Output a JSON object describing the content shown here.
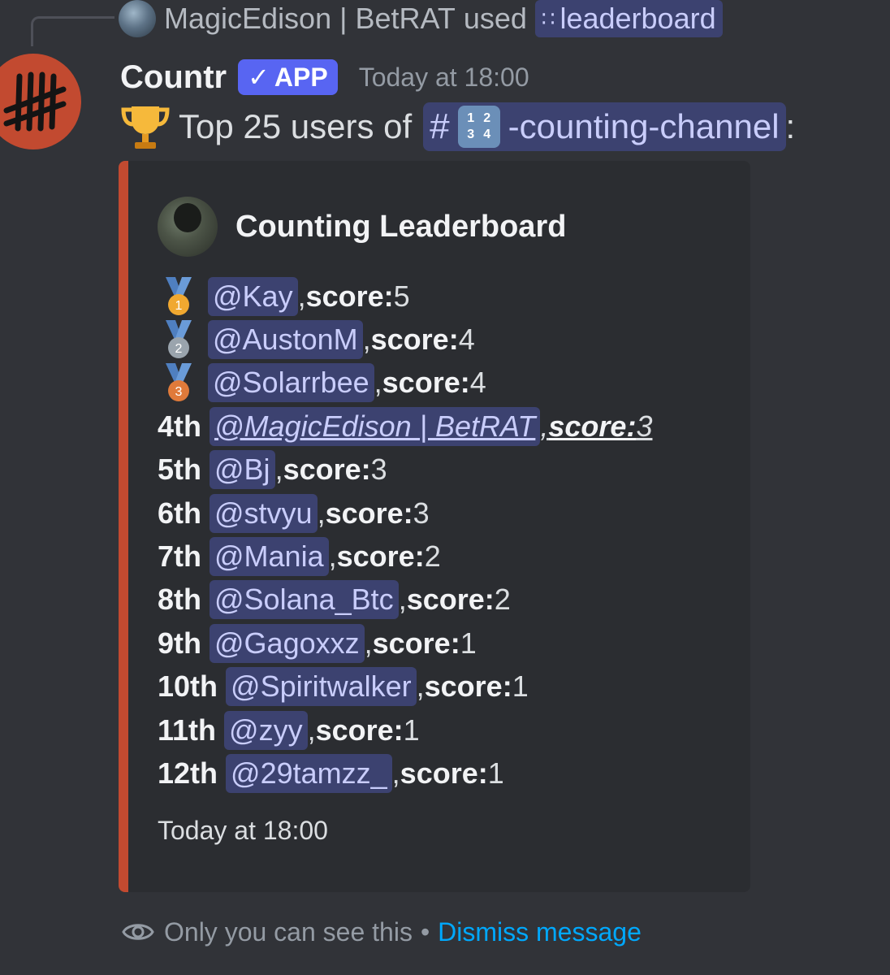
{
  "reply": {
    "user": "MagicEdison | BetRAT",
    "action": "used",
    "command": "leaderboard"
  },
  "message": {
    "author": "Countr",
    "badge": "APP",
    "timestamp": "Today at 18:00",
    "content_prefix": "Top 25 users of",
    "channel_name": "-counting-channel",
    "content_suffix": ":",
    "number_emoji": [
      "1",
      "2",
      "3",
      "4"
    ]
  },
  "embed": {
    "color": "#c24a30",
    "title": "Counting Leaderboard",
    "footer": "Today at 18:00",
    "entries": [
      {
        "rank": "1",
        "medal": "gold",
        "user": "@Kay",
        "score_label": "score:",
        "score": "5"
      },
      {
        "rank": "2",
        "medal": "silver",
        "user": "@AustonM",
        "score_label": "score:",
        "score": "4"
      },
      {
        "rank": "3",
        "medal": "bronze",
        "user": "@Solarrbee",
        "score_label": "score:",
        "score": "4"
      },
      {
        "rank": "4th",
        "user": "@MagicEdison | BetRAT",
        "score_label": "score:",
        "score": "3",
        "hovered": true
      },
      {
        "rank": "5th",
        "user": "@Bj",
        "score_label": "score:",
        "score": "3"
      },
      {
        "rank": "6th",
        "user": "@stvyu",
        "score_label": "score:",
        "score": "3"
      },
      {
        "rank": "7th",
        "user": "@Mania",
        "score_label": "score:",
        "score": "2"
      },
      {
        "rank": "8th",
        "user": "@Solana_Btc",
        "score_label": "score:",
        "score": "2"
      },
      {
        "rank": "9th",
        "user": "@Gagoxxz",
        "score_label": "score:",
        "score": "1"
      },
      {
        "rank": "10th",
        "user": "@Spiritwalker",
        "score_label": "score:",
        "score": "1"
      },
      {
        "rank": "11th",
        "user": "@zyy",
        "score_label": "score:",
        "score": "1"
      },
      {
        "rank": "12th",
        "user": "@29tamzz_",
        "score_label": "score:",
        "score": "1"
      }
    ]
  },
  "ephemeral": {
    "notice": "Only you can see this",
    "separator": "•",
    "dismiss_label": "Dismiss message"
  },
  "colors": {
    "background": "#313338",
    "embed_background": "#2b2d31",
    "mention_background": "#3c4270",
    "mention_text": "#c9cdfb",
    "app_badge": "#5865f2",
    "link": "#00a8fc",
    "gold": "#f0a830",
    "silver": "#9aa4ad",
    "bronze": "#e07a3a"
  }
}
